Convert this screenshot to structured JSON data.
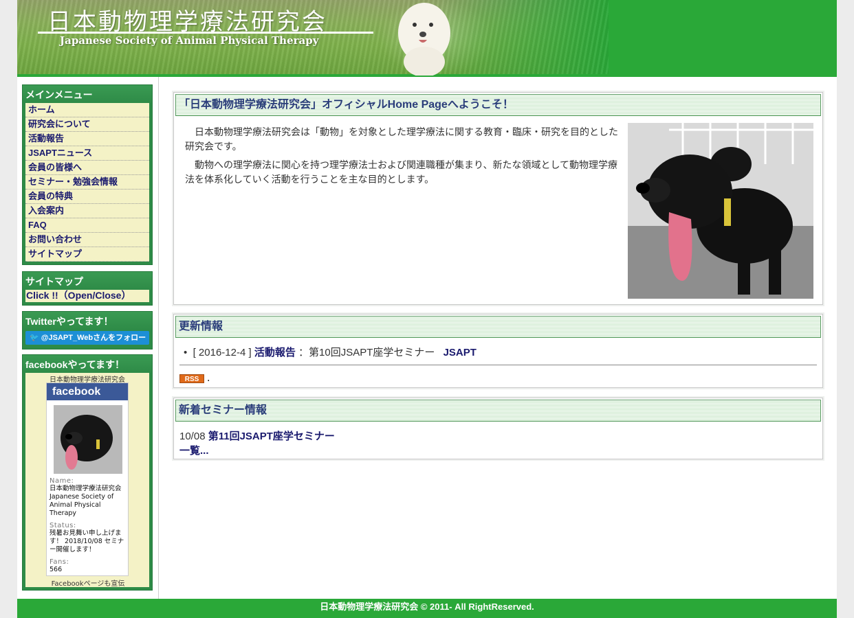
{
  "header": {
    "title": "日本動物理学療法研究会",
    "subtitle": "Japanese Society of Animal Physical Therapy"
  },
  "sidebar": {
    "main_menu": {
      "title": "メインメニュー",
      "items": [
        {
          "label": "ホーム"
        },
        {
          "label": "研究会について"
        },
        {
          "label": "活動報告"
        },
        {
          "label": "JSAPTニュース"
        },
        {
          "label": "会員の皆様へ"
        },
        {
          "label": "セミナー・勉強会情報"
        },
        {
          "label": "会員の特典"
        },
        {
          "label": "入会案内"
        },
        {
          "label": "FAQ"
        },
        {
          "label": "お問い合わせ"
        },
        {
          "label": "サイトマップ"
        }
      ]
    },
    "sitemap": {
      "title": "サイトマップ",
      "link": "Click !!（Open/Close）"
    },
    "twitter": {
      "title": "Twitterやってます！",
      "follow_button": "@JSAPT_Webさんをフォロー"
    },
    "facebook": {
      "title": "facebookやってます！",
      "page_name": "日本動物理学療法研究会",
      "logo": "facebook",
      "name_label": "Name:",
      "name_value": "日本動物理学療法研究会 Japanese Society of Animal Physical Therapy",
      "status_label": "Status:",
      "status_value": "残暑お見舞い申し上げます！ 2018/10/08 セミナー開催します！",
      "fans_label": "Fans:",
      "fans_value": "566",
      "footer": "Facebookページも宣伝"
    }
  },
  "main": {
    "welcome": {
      "heading": "「日本動物理学療法研究会」オフィシャルHome Pageへようこそ！",
      "paragraph1": "日本動物理学療法研究会は「動物」を対象とした理学療法に関する教育・臨床・研究を目的とした研究会です。",
      "paragraph2": "動物への理学療法に関心を持つ理学療法士および関連職種が集まり、新たな領域として動物理学療法を体系化していく活動を行うことを主な目的とします。"
    },
    "updates": {
      "heading": "更新情報",
      "items": [
        {
          "date": "[ 2016-12-4 ]",
          "category": "活動報告",
          "title": "：第10回JSAPT座学セミナー",
          "tag": "JSAPT"
        }
      ],
      "rss_label": "RSS",
      "rss_suffix": "."
    },
    "seminars": {
      "heading": "新着セミナー情報",
      "items": [
        {
          "date": "10/08",
          "title": "第11回JSAPT座学セミナー"
        }
      ],
      "more_link": "一覧..."
    }
  },
  "footer": {
    "copyright": "日本動物理学療法研究会 © 2011- All RightReserved."
  }
}
